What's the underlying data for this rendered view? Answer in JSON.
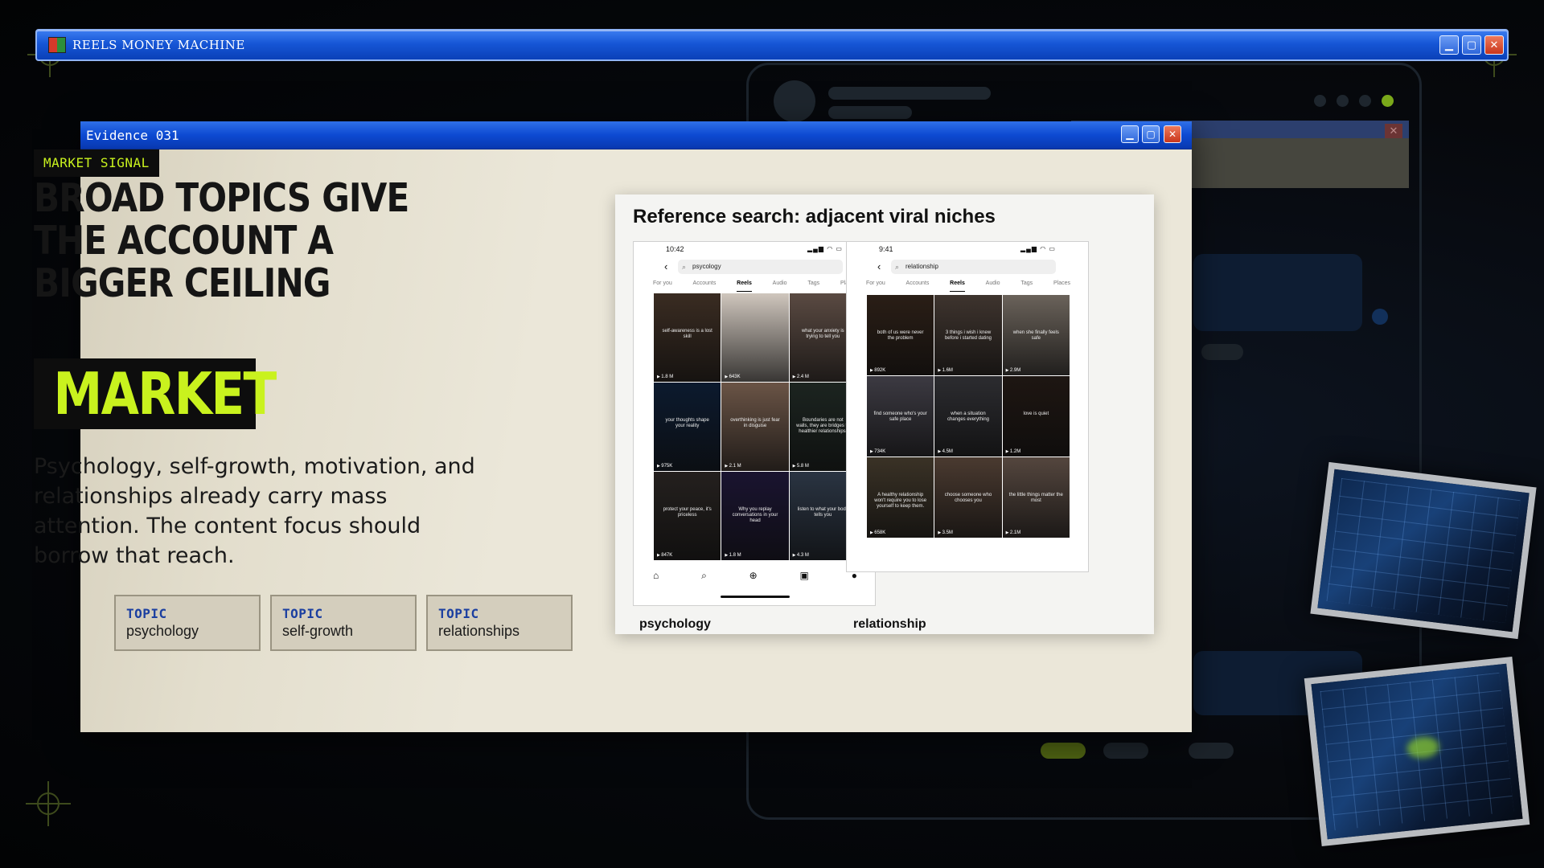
{
  "window": {
    "title": "REELS MONEY MACHINE"
  },
  "evidence": {
    "title": "Evidence 031",
    "tag": "MARKET SIGNAL",
    "headline": "BROAD TOPICS GIVE THE ACCOUNT A BIGGER CEILING",
    "keyword": "MARKET",
    "body": "Psychology, self-growth, motivation, and relationships already carry mass attention. The content focus should borrow that reach.",
    "topics": [
      {
        "label": "TOPIC",
        "value": "psychology"
      },
      {
        "label": "TOPIC",
        "value": "self-growth"
      },
      {
        "label": "TOPIC",
        "value": "relationships"
      }
    ]
  },
  "reference": {
    "title": "Reference search: adjacent viral niches",
    "phones": [
      {
        "caption": "psychology",
        "time": "10:42",
        "search": "psycology",
        "tabs": [
          "For you",
          "Accounts",
          "Reels",
          "Audio",
          "Tags",
          "Places"
        ],
        "active_tab": "Reels",
        "tiles": [
          {
            "views": "1.8 M",
            "caption": "self-awareness is a lost skill",
            "bg": "#3a2c22"
          },
          {
            "views": "643K",
            "caption": "",
            "bg": "#cfc6bd"
          },
          {
            "views": "2.4 M",
            "caption": "what your anxiety is trying to tell you",
            "bg": "#5a4a42"
          },
          {
            "views": "975K",
            "caption": "your thoughts shape your reality",
            "bg": "#0c1a2e"
          },
          {
            "views": "2.1 M",
            "caption": "overthinking is just fear in disguise",
            "bg": "#6a5446"
          },
          {
            "views": "5.8 M",
            "caption": "Boundaries are not walls, they are bridges to healthier relationships.",
            "bg": "#1c2420"
          },
          {
            "views": "847K",
            "caption": "protect your peace, it's priceless",
            "bg": "#24201e"
          },
          {
            "views": "1.8 M",
            "caption": "Why you replay conversations in your head",
            "bg": "#1a1430"
          },
          {
            "views": "4.3 M",
            "caption": "listen to what your body tells you",
            "bg": "#2a3442"
          }
        ]
      },
      {
        "caption": "relationship",
        "time": "9:41",
        "search": "relationship",
        "tabs": [
          "For you",
          "Accounts",
          "Reels",
          "Audio",
          "Tags",
          "Places"
        ],
        "active_tab": "Reels",
        "tiles": [
          {
            "views": "892K",
            "caption": "both of us were never the problem",
            "bg": "#2a1e16"
          },
          {
            "views": "1.6M",
            "caption": "3 things i wish i knew before i started dating",
            "bg": "#3e342e"
          },
          {
            "views": "2.9M",
            "caption": "when she finally feels safe",
            "bg": "#6a625a"
          },
          {
            "views": "734K",
            "caption": "find someone who's your safe place",
            "bg": "#3c3a42"
          },
          {
            "views": "4.5M",
            "caption": "when a situation changes everything",
            "bg": "#2c2c30"
          },
          {
            "views": "1.2M",
            "caption": "love is quiet",
            "bg": "#1e1612"
          },
          {
            "views": "658K",
            "caption": "A healthy relationship won't require you to lose yourself to keep them.",
            "bg": "#3a3226"
          },
          {
            "views": "3.5M",
            "caption": "choose someone who chooses you",
            "bg": "#4a3a30"
          },
          {
            "views": "2.1M",
            "caption": "the little things matter the most",
            "bg": "#54463e"
          }
        ]
      }
    ]
  },
  "colors": {
    "accent": "#c9f21e",
    "titlebar": "#1656d6",
    "panel": "#ebe7d9"
  }
}
